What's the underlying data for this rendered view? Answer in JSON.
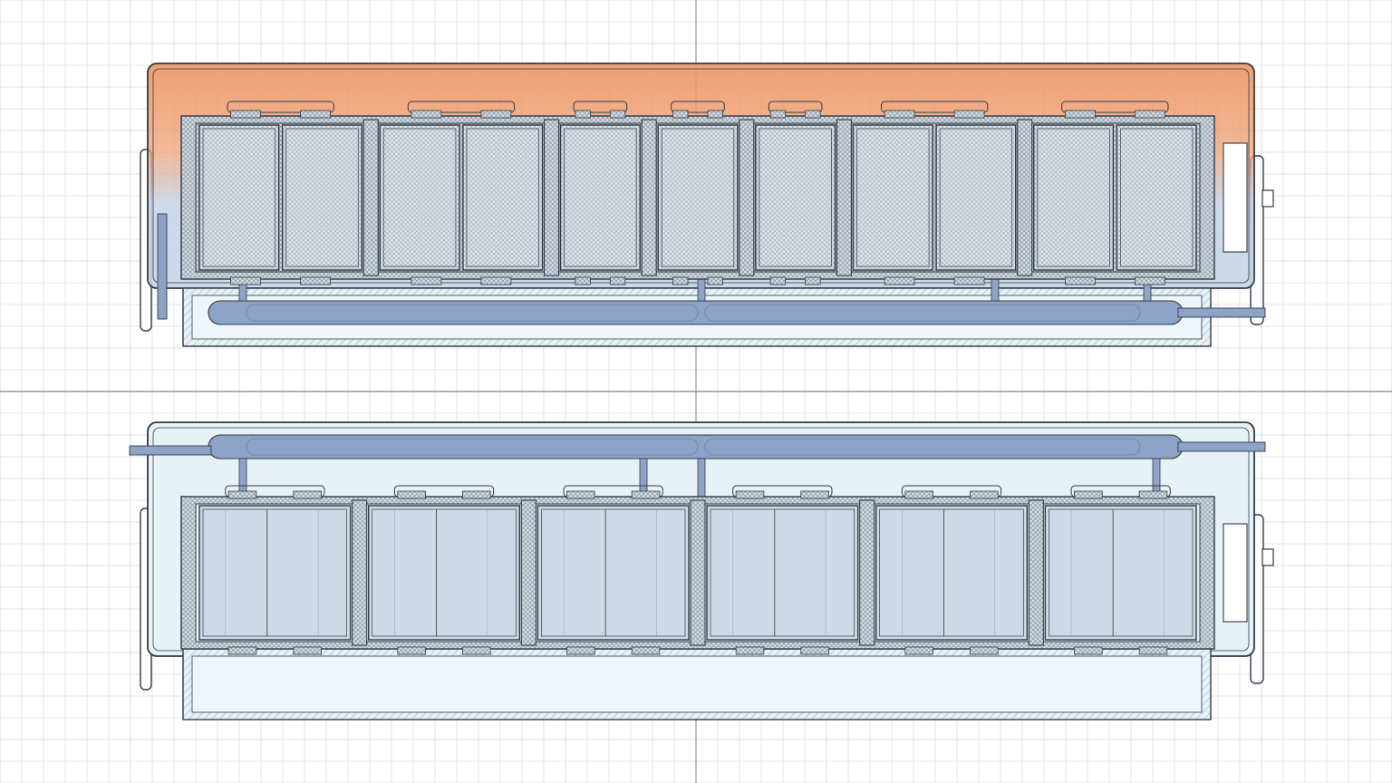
{
  "diagram": {
    "views": [
      {
        "id": "top",
        "heated": true,
        "cell_modules": [
          {
            "cells": 2,
            "divided": false
          },
          {
            "cells": 2,
            "divided": false
          },
          {
            "cells": 1,
            "divided": false
          },
          {
            "cells": 1,
            "divided": false
          },
          {
            "cells": 1,
            "divided": false
          },
          {
            "cells": 2,
            "divided": false
          },
          {
            "cells": 2,
            "divided": false
          }
        ]
      },
      {
        "id": "bottom",
        "heated": false,
        "cell_modules": [
          {
            "cells": 1,
            "divided": true
          },
          {
            "cells": 1,
            "divided": true
          },
          {
            "cells": 1,
            "divided": true
          },
          {
            "cells": 1,
            "divided": true
          },
          {
            "cells": 1,
            "divided": true
          },
          {
            "cells": 1,
            "divided": true
          }
        ]
      }
    ],
    "colors": {
      "background": "#ffffff",
      "grid": "#dfe3e8",
      "grid_axis": "#7b7f86",
      "outline": "#2f3a46",
      "housing_fill": "#e7f2f7",
      "hatch": "#9ab6c8",
      "cell_fill": "#cdd9e6",
      "coolant": "#8ea3c8",
      "coolant_dark": "#7389b6",
      "heat_hot": "#ee9a6a",
      "heat_cool": "#c5d4e6",
      "spacer_fill": "#d3dbe3"
    }
  }
}
